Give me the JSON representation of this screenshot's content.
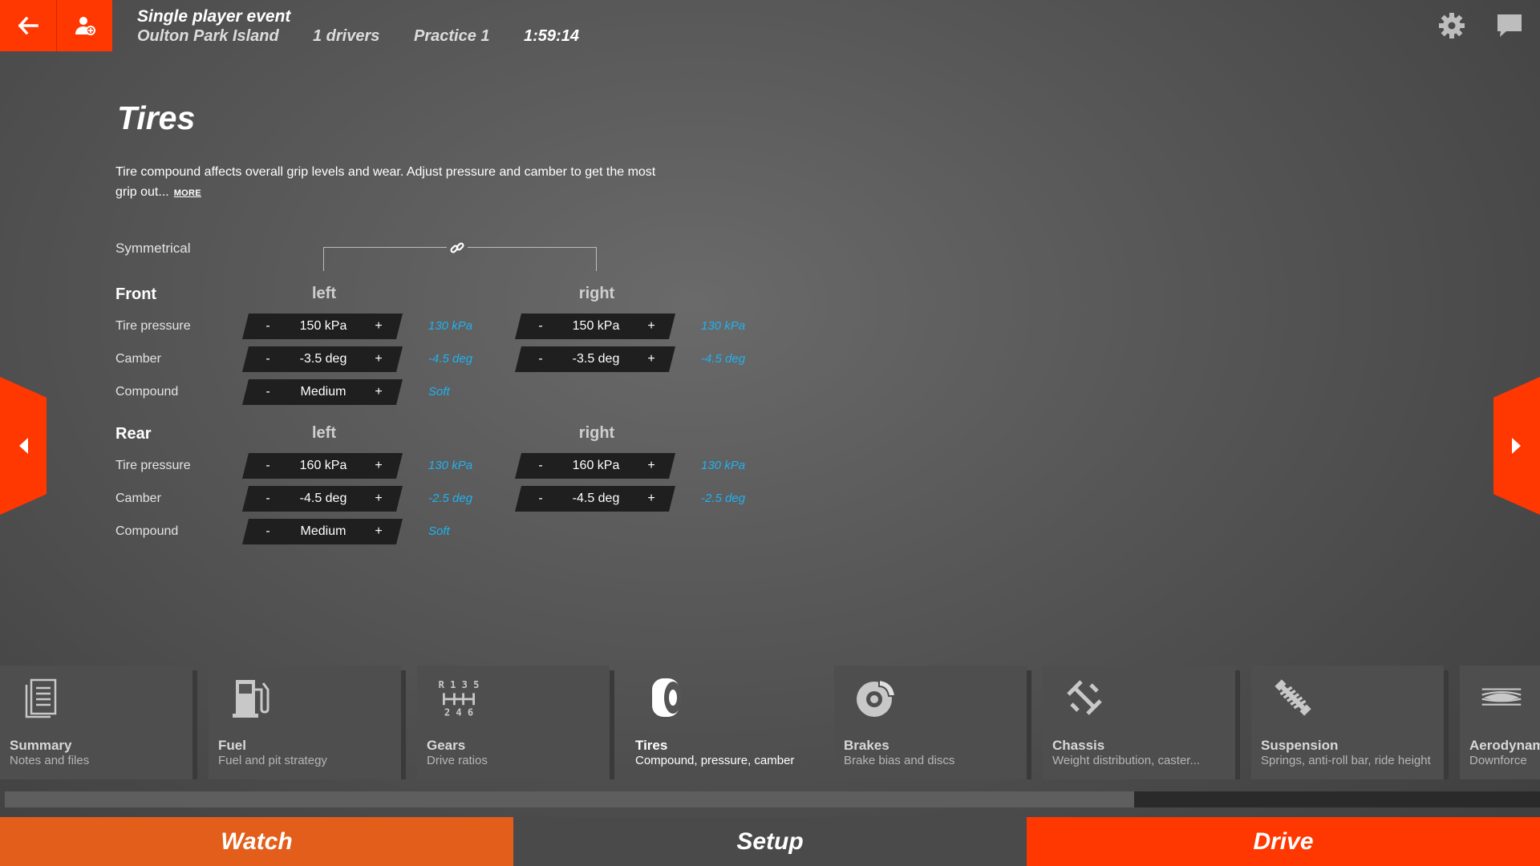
{
  "header": {
    "event_title": "Single player event",
    "track": "Oulton Park Island",
    "drivers": "1 drivers",
    "session": "Practice 1",
    "time": "1:59:14",
    "icons": [
      "back-arrow-icon",
      "user-icon",
      "gear-icon",
      "chat-icon"
    ]
  },
  "page": {
    "title": "Tires",
    "description": "Tire compound affects overall grip levels and wear. Adjust pressure and camber to get the most grip out...",
    "more_label": "MORE",
    "symmetrical_label": "Symmetrical"
  },
  "stepper": {
    "minus": "-",
    "plus": "+"
  },
  "front": {
    "label": "Front",
    "left_label": "left",
    "right_label": "right",
    "tire_pressure": {
      "label": "Tire pressure",
      "left": "150 kPa",
      "left_ref": "130 kPa",
      "right": "150 kPa",
      "right_ref": "130 kPa"
    },
    "camber": {
      "label": "Camber",
      "left": "-3.5 deg",
      "left_ref": "-4.5 deg",
      "right": "-3.5 deg",
      "right_ref": "-4.5 deg"
    },
    "compound": {
      "label": "Compound",
      "left": "Medium",
      "left_ref": "Soft"
    }
  },
  "rear": {
    "label": "Rear",
    "left_label": "left",
    "right_label": "right",
    "tire_pressure": {
      "label": "Tire pressure",
      "left": "160 kPa",
      "left_ref": "130 kPa",
      "right": "160 kPa",
      "right_ref": "130 kPa"
    },
    "camber": {
      "label": "Camber",
      "left": "-4.5 deg",
      "left_ref": "-2.5 deg",
      "right": "-4.5 deg",
      "right_ref": "-2.5 deg"
    },
    "compound": {
      "label": "Compound",
      "left": "Medium",
      "left_ref": "Soft"
    }
  },
  "categories": [
    {
      "name": "Summary",
      "sub": "Notes and files",
      "icon": "document-icon"
    },
    {
      "name": "Fuel",
      "sub": "Fuel and pit strategy",
      "icon": "fuel-pump-icon"
    },
    {
      "name": "Gears",
      "sub": "Drive ratios",
      "icon": "gear-shift-icon",
      "icon_text_top": "R 1 3 5",
      "icon_text_bottom": "2 4 6"
    },
    {
      "name": "Tires",
      "sub": "Compound, pressure, camber",
      "icon": "tire-icon",
      "active": true
    },
    {
      "name": "Brakes",
      "sub": "Brake bias and discs",
      "icon": "brake-disc-icon"
    },
    {
      "name": "Chassis",
      "sub": "Weight distribution, caster...",
      "icon": "chassis-icon"
    },
    {
      "name": "Suspension",
      "sub": "Springs, anti-roll bar, ride height",
      "icon": "spring-icon"
    },
    {
      "name": "Aerodynamics",
      "sub": "Downforce",
      "icon": "aero-icon"
    }
  ],
  "tabs": {
    "watch": "Watch",
    "setup": "Setup",
    "drive": "Drive"
  },
  "colors": {
    "accent": "#ff3700",
    "watch": "#e35e1a",
    "reference": "#1fb2f0",
    "stepper_bg": "#1f1f1f"
  }
}
